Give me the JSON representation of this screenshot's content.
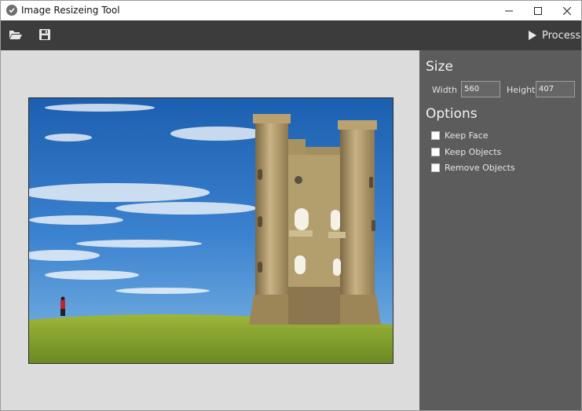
{
  "window": {
    "title": "Image Resizeing Tool"
  },
  "toolbar": {
    "open_icon": "folder-open-icon",
    "save_icon": "save-icon",
    "process_label": "Process"
  },
  "panel": {
    "size_title": "Size",
    "width_label": "Width",
    "width_value": "560",
    "height_label": "Height",
    "height_value": "407",
    "options_title": "Options",
    "options": [
      {
        "label": "Keep Face",
        "checked": false
      },
      {
        "label": "Keep Objects",
        "checked": false
      },
      {
        "label": "Remove Objects",
        "checked": false
      }
    ]
  },
  "colors": {
    "toolbar_bg": "#3c3c3c",
    "panel_bg": "#5c5c5c",
    "canvas_bg": "#dcdcdc"
  }
}
